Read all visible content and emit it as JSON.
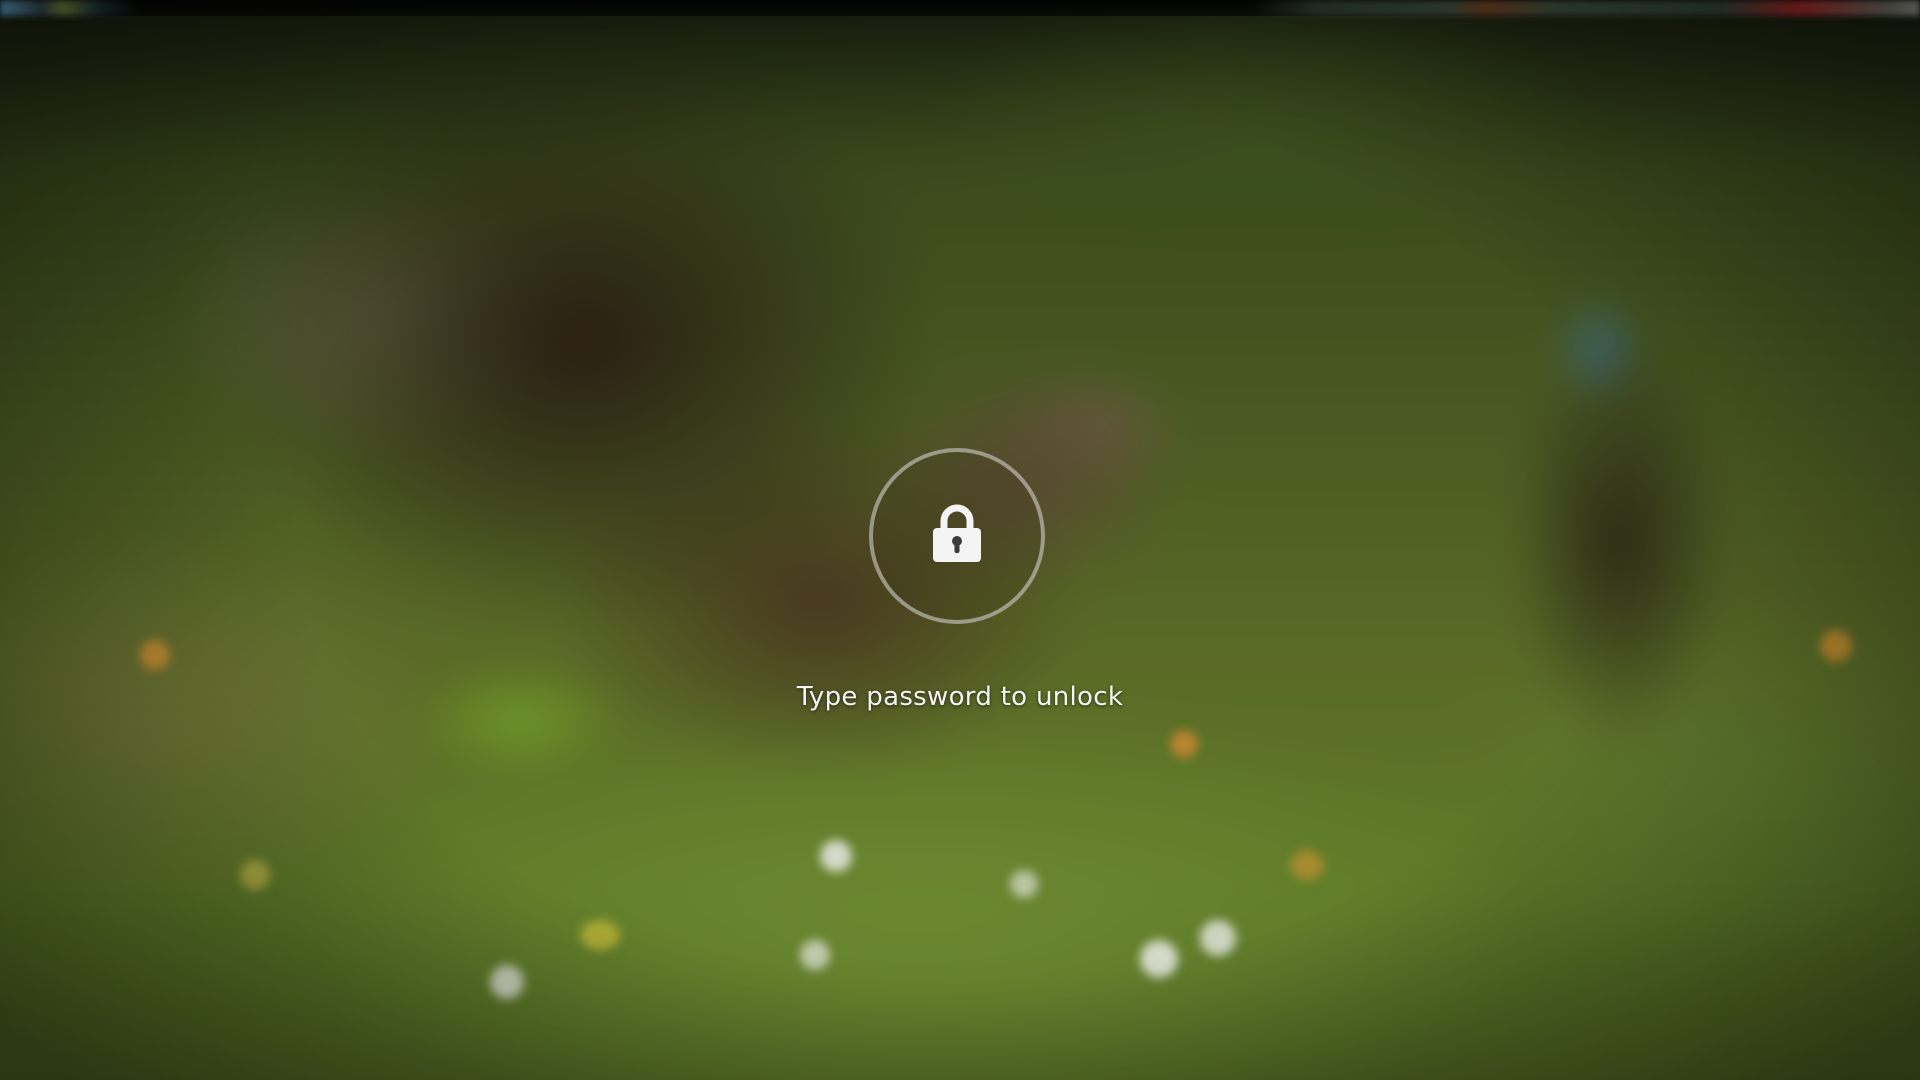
{
  "lock_screen": {
    "prompt": "Type password to unlock",
    "icon": "padlock-icon"
  },
  "colors": {
    "text": "#f4f4f4",
    "ring": "#dcdcdc"
  }
}
